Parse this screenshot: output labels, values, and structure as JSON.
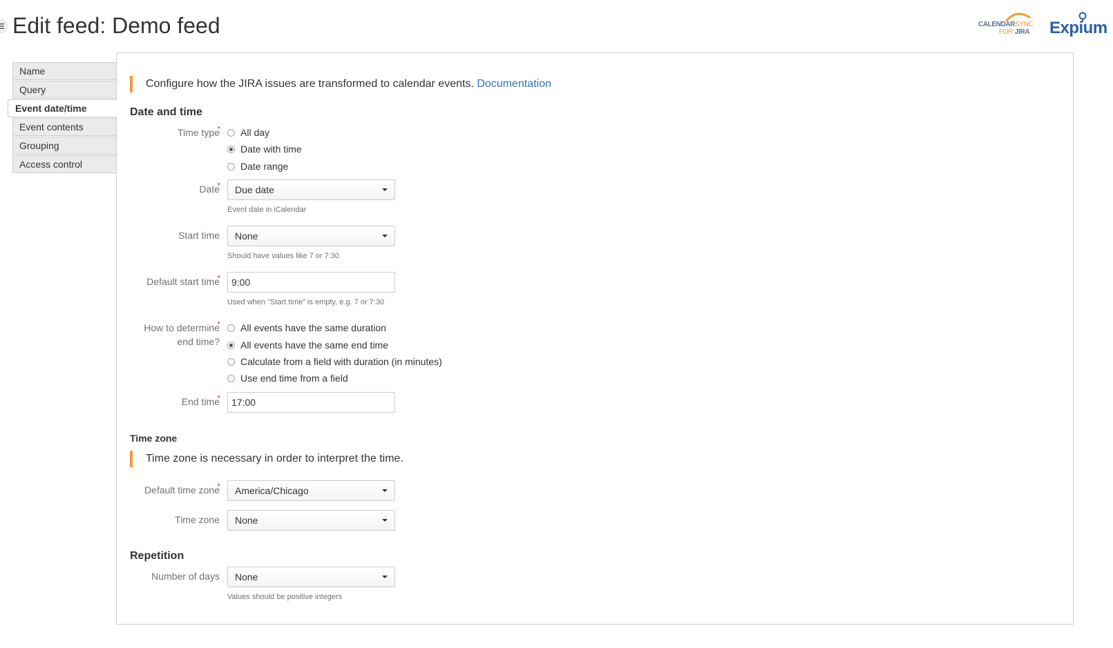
{
  "header": {
    "title": "Edit feed: Demo feed",
    "menu_icon": "hamburger-icon",
    "logos": {
      "calendarsync": {
        "line1_a": "CALENDAR",
        "line1_b": "SYNC",
        "line2_a": "FOR",
        "line2_b": "JIRA"
      },
      "expium": "Expium"
    }
  },
  "nav": {
    "items": [
      {
        "label": "Name",
        "active": false
      },
      {
        "label": "Query",
        "active": false
      },
      {
        "label": "Event date/time",
        "active": true
      },
      {
        "label": "Event contents",
        "active": false
      },
      {
        "label": "Grouping",
        "active": false
      },
      {
        "label": "Access control",
        "active": false
      }
    ]
  },
  "intro": {
    "text": "Configure how the JIRA issues are transformed to calendar events.",
    "link": "Documentation"
  },
  "date_time": {
    "heading": "Date and time",
    "time_type": {
      "label": "Time type",
      "options": [
        "All day",
        "Date with time",
        "Date range"
      ],
      "selected": "Date with time"
    },
    "date": {
      "label": "Date",
      "value": "Due date",
      "hint": "Event date in iCalendar"
    },
    "start_time": {
      "label": "Start time",
      "value": "None",
      "hint": "Should have values like 7 or 7:30"
    },
    "default_start_time": {
      "label": "Default start time",
      "value": "9:00",
      "hint": "Used when \"Start time\" is empty, e.g. 7 or 7:30"
    },
    "end_method": {
      "label_line1": "How to determine",
      "label_line2": "end time?",
      "options": [
        "All events have the same duration",
        "All events have the same end time",
        "Calculate from a field with duration (in minutes)",
        "Use end time from a field"
      ],
      "selected": "All events have the same end time"
    },
    "end_time": {
      "label": "End time",
      "value": "17:00"
    }
  },
  "time_zone": {
    "heading": "Time zone",
    "info": "Time zone is necessary in order to interpret the time.",
    "default_time_zone": {
      "label": "Default time zone",
      "value": "America/Chicago"
    },
    "time_zone_field": {
      "label": "Time zone",
      "value": "None"
    }
  },
  "repetition": {
    "heading": "Repetition",
    "number_of_days": {
      "label": "Number of days",
      "value": "None",
      "hint": "Values should be positive integers"
    }
  },
  "colors": {
    "accent": "#f29a38",
    "link": "#3572b0",
    "required": "#d04437",
    "brand_blue": "#2c5fa6"
  }
}
